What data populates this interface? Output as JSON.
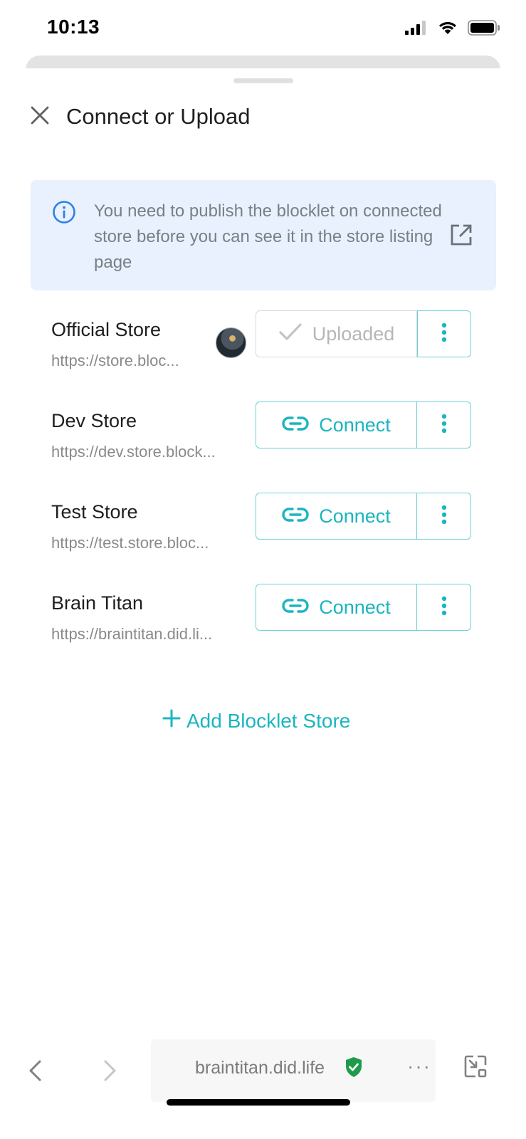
{
  "status_bar": {
    "time": "10:13",
    "icons": [
      "cellular-signal-icon",
      "wifi-icon",
      "battery-icon"
    ]
  },
  "header": {
    "title": "Connect or Upload",
    "close_icon": "close-icon"
  },
  "info_banner": {
    "text": "You need to publish the blocklet on connected store before you can see it in the store listing page",
    "icon": "info-circle-icon",
    "link_icon": "external-link-icon"
  },
  "stores": [
    {
      "name": "Official Store",
      "url": "https://store.bloc...",
      "has_avatar": true,
      "action_label": "Uploaded",
      "action_icon": "check-icon",
      "action_state": "disabled"
    },
    {
      "name": "Dev Store",
      "url": "https://dev.store.block...",
      "has_avatar": false,
      "action_label": "Connect",
      "action_icon": "link-icon",
      "action_state": "enabled"
    },
    {
      "name": "Test Store",
      "url": "https://test.store.bloc...",
      "has_avatar": false,
      "action_label": "Connect",
      "action_icon": "link-icon",
      "action_state": "enabled"
    },
    {
      "name": "Brain Titan",
      "url": "https://braintitan.did.li...",
      "has_avatar": false,
      "action_label": "Connect",
      "action_icon": "link-icon",
      "action_state": "enabled"
    }
  ],
  "add_store": {
    "label": "Add Blocklet Store",
    "icon": "plus-icon"
  },
  "browser_bar": {
    "url": "braintitan.did.life",
    "secure_icon": "shield-check-icon",
    "more": "···"
  },
  "colors": {
    "accent": "#1bb5c0",
    "accent_border": "#6cd2d7",
    "banner_bg": "#e8f1fd",
    "info_blue": "#2f7fe8",
    "secure_green": "#1e9b4a"
  }
}
